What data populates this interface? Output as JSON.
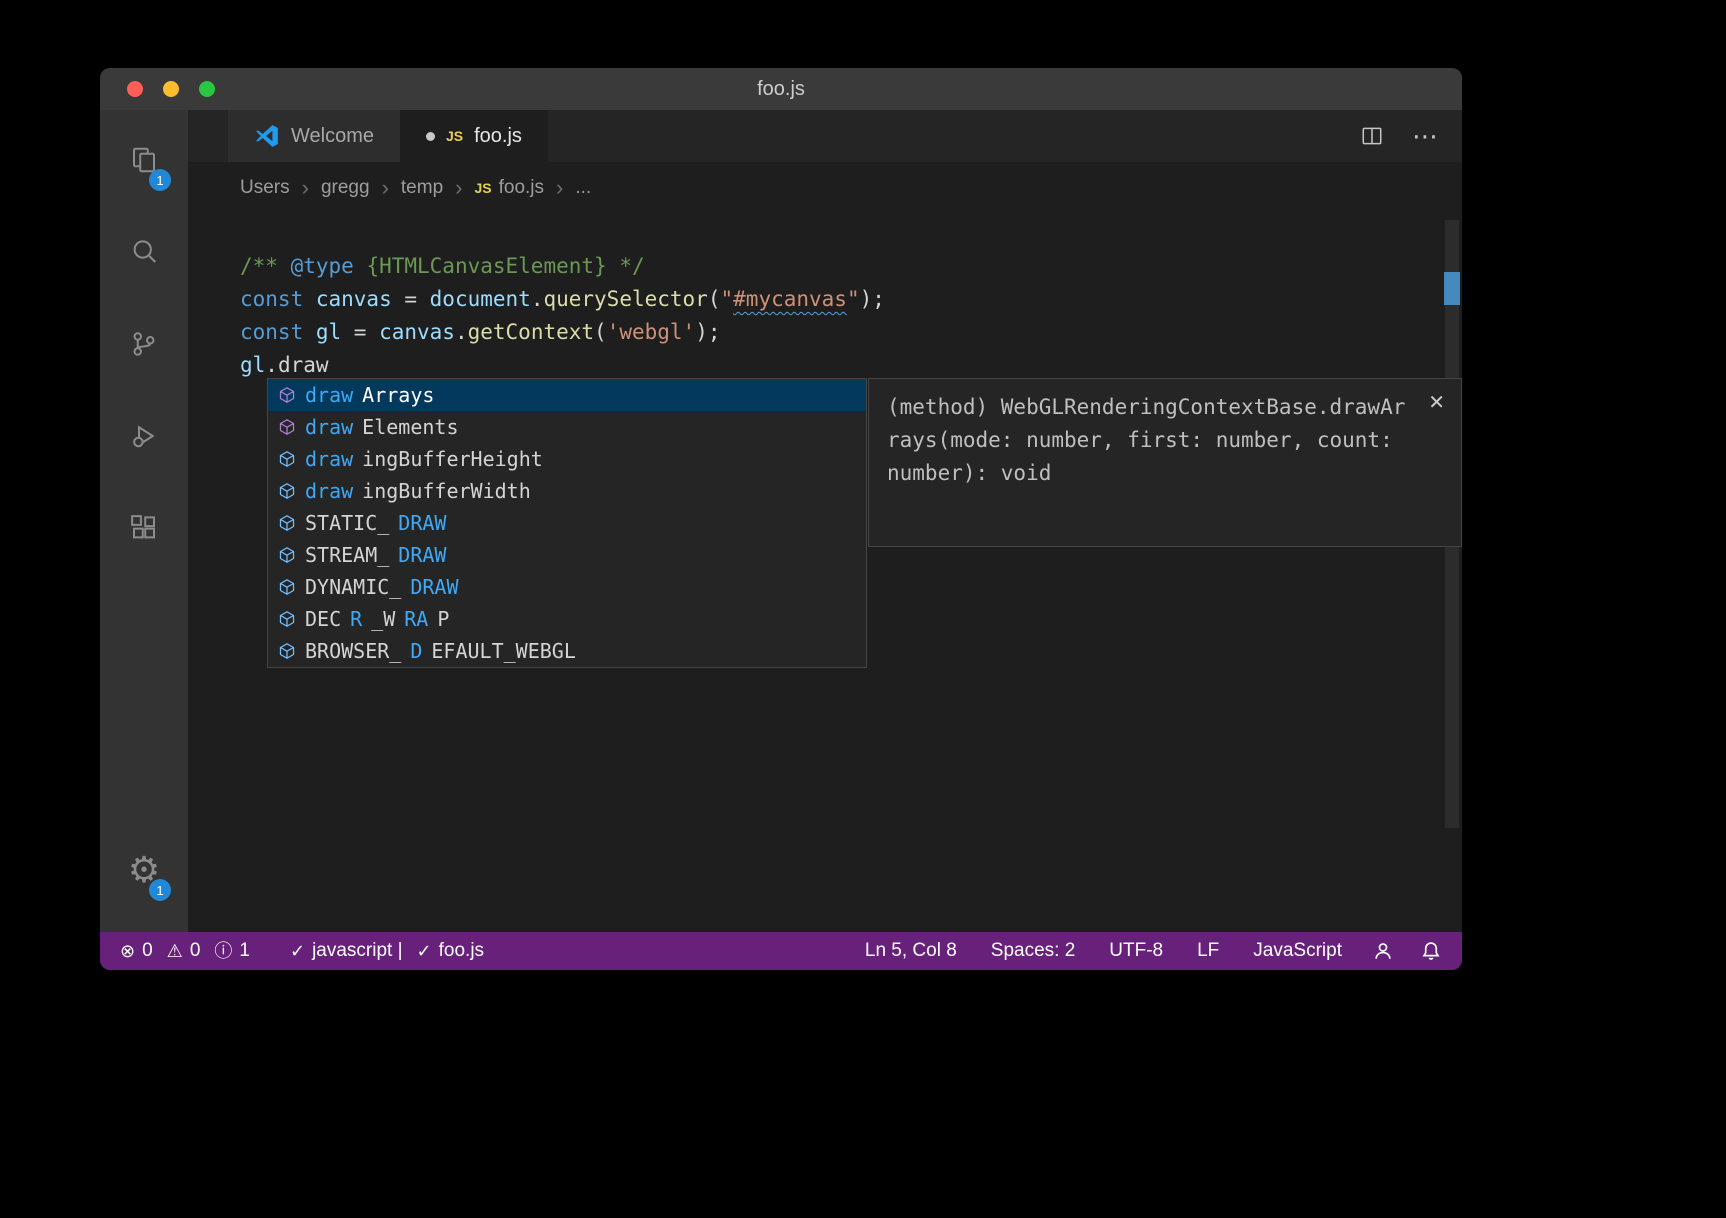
{
  "window": {
    "title": "foo.js"
  },
  "colors": {
    "statusbar_bg": "#68217A",
    "badge_bg": "#2188D8",
    "method_icon": "#B180D7",
    "field_icon": "#75BEFF",
    "match_highlight": "#3FA9F5",
    "selected_row_bg": "#04395E",
    "squiggle": "#4FA5E0",
    "overview_marker": "#4B9AD8",
    "comment": "#6A9955",
    "keyword": "#569CD6",
    "variable": "#9CDCFE",
    "function": "#DCDCAA",
    "string": "#CE9178",
    "traffic_close": "#FF5F57",
    "traffic_minimize": "#FEBC2E",
    "traffic_zoom": "#28C840"
  },
  "activity_bar": {
    "explorer_badge": "1",
    "settings_badge": "1"
  },
  "tabs": [
    {
      "label": "Welcome"
    },
    {
      "label": "foo.js"
    }
  ],
  "tab_actions": {
    "more": "⋯"
  },
  "icons": {
    "js_label": "JS"
  },
  "breadcrumb": {
    "items": [
      {
        "label": "Users"
      },
      {
        "label": "gregg"
      },
      {
        "label": "temp"
      },
      {
        "label": "foo.js",
        "icon": "js"
      },
      {
        "label": "..."
      }
    ]
  },
  "editor": {
    "lines": [
      {
        "tokens": [
          {
            "t": "/** ",
            "c": "comment"
          },
          {
            "t": "@type",
            "c": "doctag"
          },
          {
            "t": " {HTMLCanvasElement}",
            "c": "comment"
          },
          {
            "t": " */",
            "c": "comment"
          }
        ]
      },
      {
        "tokens": [
          {
            "t": "const ",
            "c": "kw"
          },
          {
            "t": "canvas",
            "c": "var"
          },
          {
            "t": " = ",
            "c": "plain"
          },
          {
            "t": "document",
            "c": "var"
          },
          {
            "t": ".",
            "c": "plain"
          },
          {
            "t": "querySelector",
            "c": "fn"
          },
          {
            "t": "(",
            "c": "plain"
          },
          {
            "t": "\"",
            "c": "str"
          },
          {
            "t": "#mycanvas",
            "c": "str",
            "squiggle": true
          },
          {
            "t": "\"",
            "c": "str"
          },
          {
            "t": ");",
            "c": "plain"
          }
        ]
      },
      {
        "tokens": [
          {
            "t": "const ",
            "c": "kw"
          },
          {
            "t": "gl",
            "c": "var"
          },
          {
            "t": " = ",
            "c": "plain"
          },
          {
            "t": "canvas",
            "c": "var"
          },
          {
            "t": ".",
            "c": "plain"
          },
          {
            "t": "getContext",
            "c": "fn"
          },
          {
            "t": "(",
            "c": "plain"
          },
          {
            "t": "'webgl'",
            "c": "str"
          },
          {
            "t": ");",
            "c": "plain"
          }
        ]
      },
      {
        "tokens": [
          {
            "t": "gl",
            "c": "var"
          },
          {
            "t": ".draw",
            "c": "plain"
          }
        ]
      }
    ]
  },
  "suggest": {
    "items": [
      {
        "label": "drawArrays",
        "kind": "method",
        "selected": true,
        "segments": [
          {
            "t": "draw",
            "h": true
          },
          {
            "t": "Arrays"
          }
        ]
      },
      {
        "label": "drawElements",
        "kind": "method",
        "segments": [
          {
            "t": "draw",
            "h": true
          },
          {
            "t": "Elements"
          }
        ]
      },
      {
        "label": "drawingBufferHeight",
        "kind": "field",
        "segments": [
          {
            "t": "draw",
            "h": true
          },
          {
            "t": "ingBufferHeight"
          }
        ]
      },
      {
        "label": "drawingBufferWidth",
        "kind": "field",
        "segments": [
          {
            "t": "draw",
            "h": true
          },
          {
            "t": "ingBufferWidth"
          }
        ]
      },
      {
        "label": "STATIC_DRAW",
        "kind": "field",
        "segments": [
          {
            "t": "STATIC_"
          },
          {
            "t": "DRAW",
            "h": true
          }
        ]
      },
      {
        "label": "STREAM_DRAW",
        "kind": "field",
        "segments": [
          {
            "t": "STREAM_"
          },
          {
            "t": "DRAW",
            "h": true
          }
        ]
      },
      {
        "label": "DYNAMIC_DRAW",
        "kind": "field",
        "segments": [
          {
            "t": "DYNAMIC_"
          },
          {
            "t": "DRAW",
            "h": true
          }
        ]
      },
      {
        "label": "DECR_WRAP",
        "kind": "field",
        "segments": [
          {
            "t": "DEC"
          },
          {
            "t": "R",
            "h": true
          },
          {
            "t": "_W"
          },
          {
            "t": "RA",
            "h": true
          },
          {
            "t": "P"
          }
        ]
      },
      {
        "label": "BROWSER_DEFAULT_WEBGL",
        "kind": "field",
        "segments": [
          {
            "t": "BROWSER_"
          },
          {
            "t": "D",
            "h": true
          },
          {
            "t": "EFAULT_WEBGL"
          }
        ]
      }
    ]
  },
  "docs": {
    "lines": [
      "(method) WebGLRenderingContextBase.drawAr",
      "rays(mode: number, first: number, count:",
      "number): void"
    ],
    "close": "✕"
  },
  "statusbar": {
    "left": [
      {
        "name": "error-count",
        "icon": "error-icon",
        "glyph": "⊗",
        "text": "0"
      },
      {
        "name": "warning-count",
        "icon": "warning-icon",
        "glyph": "⚠",
        "text": "0"
      },
      {
        "name": "info-count",
        "icon": "info-icon",
        "glyph": "ⓘ",
        "text": "1"
      },
      {
        "name": "linter-javascript",
        "icon": "check-icon",
        "glyph": "✓",
        "text": "javascript |",
        "gap": true
      },
      {
        "name": "linter-foojs",
        "icon": "check-icon",
        "glyph": "✓",
        "text": "foo.js"
      }
    ],
    "right": [
      {
        "name": "cursor-position",
        "text": "Ln 5, Col 8"
      },
      {
        "name": "indentation",
        "text": "Spaces: 2"
      },
      {
        "name": "encoding",
        "text": "UTF-8"
      },
      {
        "name": "eol",
        "text": "LF"
      },
      {
        "name": "language-mode",
        "text": "JavaScript"
      }
    ]
  }
}
